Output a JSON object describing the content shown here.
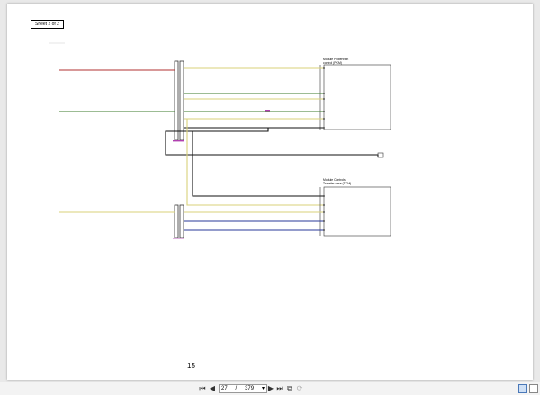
{
  "document": {
    "sheet_label": "Sheet 2 of 2",
    "page_number": "15",
    "modules": [
      {
        "name": "Module Powertrain control (PCM)"
      },
      {
        "name": "Module Controls Transfer case (TCM)"
      }
    ]
  },
  "toolbar": {
    "first_page_icon": "first-page-icon",
    "prev_page_icon": "prev-page-icon",
    "current_page": "27",
    "separator": "/",
    "total_pages": "379",
    "next_page_icon": "next-page-icon",
    "last_page_icon": "last-page-icon",
    "colors": {
      "wire_red": "#b03030",
      "wire_yellow": "#d9d27a",
      "wire_green": "#3a7a2a",
      "wire_black": "#111111",
      "wire_blue": "#2a3a9a",
      "connector_magenta": "#b040b0"
    }
  }
}
